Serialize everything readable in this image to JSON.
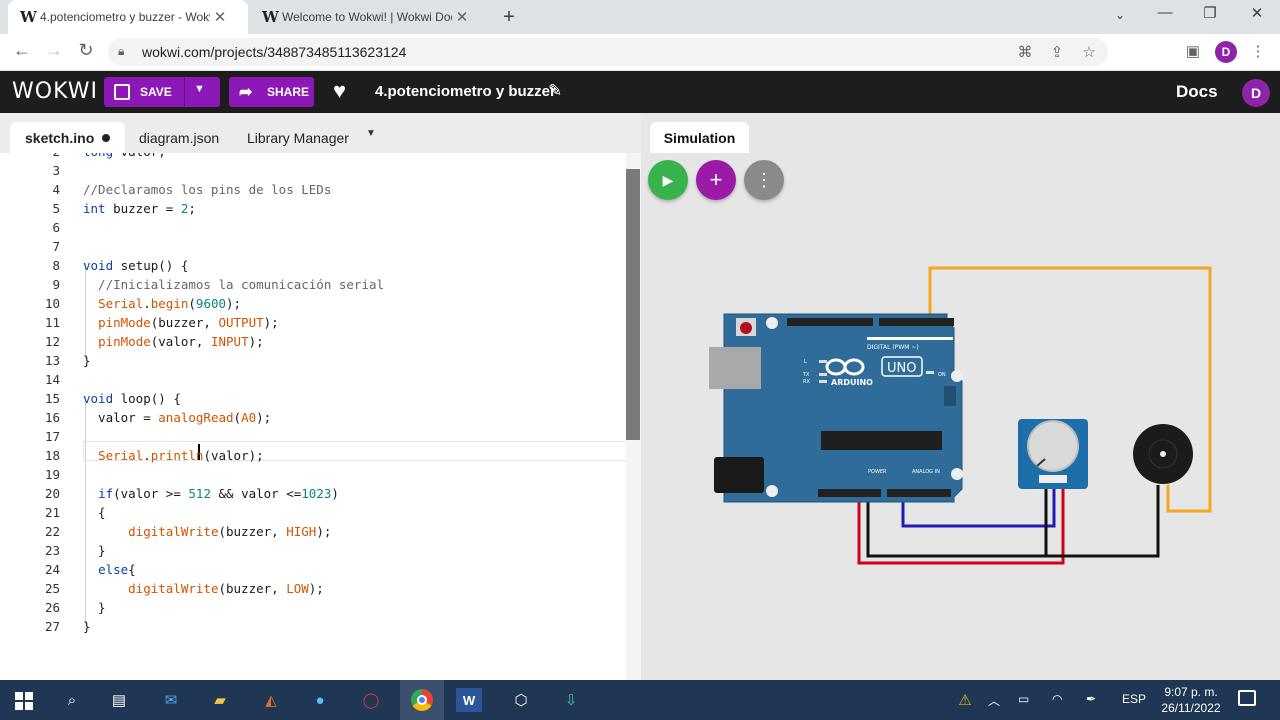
{
  "browser": {
    "tabs": [
      {
        "title": "4.potenciometro y buzzer - Wokwi",
        "active": true
      },
      {
        "title": "Welcome to Wokwi! | Wokwi Docs",
        "active": false
      }
    ],
    "url": "wokwi.com/projects/348873485113623124",
    "profile_initial": "D"
  },
  "header": {
    "logo": "WOKWI",
    "save_label": "SAVE",
    "share_label": "SHARE",
    "project_name": "4.potenciometro y buzzer",
    "docs_label": "Docs",
    "avatar_initial": "D"
  },
  "editor": {
    "tabs": [
      {
        "label": "sketch.ino",
        "modified": true
      },
      {
        "label": "diagram.json"
      },
      {
        "label": "Library Manager"
      }
    ],
    "lines": [
      {
        "n": "2",
        "text": "long valor;"
      },
      {
        "n": "3",
        "text": ""
      },
      {
        "n": "4",
        "text": "//Declaramos los pins de los LEDs"
      },
      {
        "n": "5",
        "text": "int buzzer = 2;"
      },
      {
        "n": "6",
        "text": ""
      },
      {
        "n": "7",
        "text": ""
      },
      {
        "n": "8",
        "text": "void setup() {"
      },
      {
        "n": "9",
        "text": "  //Inicializamos la comunicación serial"
      },
      {
        "n": "10",
        "text": "  Serial.begin(9600);"
      },
      {
        "n": "11",
        "text": "  pinMode(buzzer, OUTPUT);"
      },
      {
        "n": "12",
        "text": "  pinMode(valor, INPUT);"
      },
      {
        "n": "13",
        "text": "}"
      },
      {
        "n": "14",
        "text": ""
      },
      {
        "n": "15",
        "text": "void loop() {"
      },
      {
        "n": "16",
        "text": "  valor = analogRead(A0);"
      },
      {
        "n": "17",
        "text": ""
      },
      {
        "n": "18",
        "text": "  Serial.println(valor);"
      },
      {
        "n": "19",
        "text": ""
      },
      {
        "n": "20",
        "text": "  if(valor >= 512 && valor <=1023)"
      },
      {
        "n": "21",
        "text": "  {"
      },
      {
        "n": "22",
        "text": "      digitalWrite(buzzer, HIGH);"
      },
      {
        "n": "23",
        "text": "  }"
      },
      {
        "n": "24",
        "text": "  else{"
      },
      {
        "n": "25",
        "text": "      digitalWrite(buzzer, LOW);"
      },
      {
        "n": "26",
        "text": "  }"
      },
      {
        "n": "27",
        "text": "}"
      }
    ]
  },
  "simulation": {
    "tab_label": "Simulation",
    "board": {
      "brand": "ARDUINO",
      "model": "UNO",
      "digital_label": "DIGITAL (PWM ~)",
      "power_label": "POWER",
      "analog_label": "ANALOG IN",
      "on_label": "ON",
      "tx_label": "TX",
      "rx_label": "RX",
      "l_label": "L"
    },
    "wire_colors": {
      "orange": "#f5a623",
      "blue": "#1d1db5",
      "red": "#d0021b",
      "black": "#111111"
    }
  },
  "taskbar": {
    "language": "ESP",
    "time": "9:07 p. m.",
    "date": "26/11/2022"
  }
}
